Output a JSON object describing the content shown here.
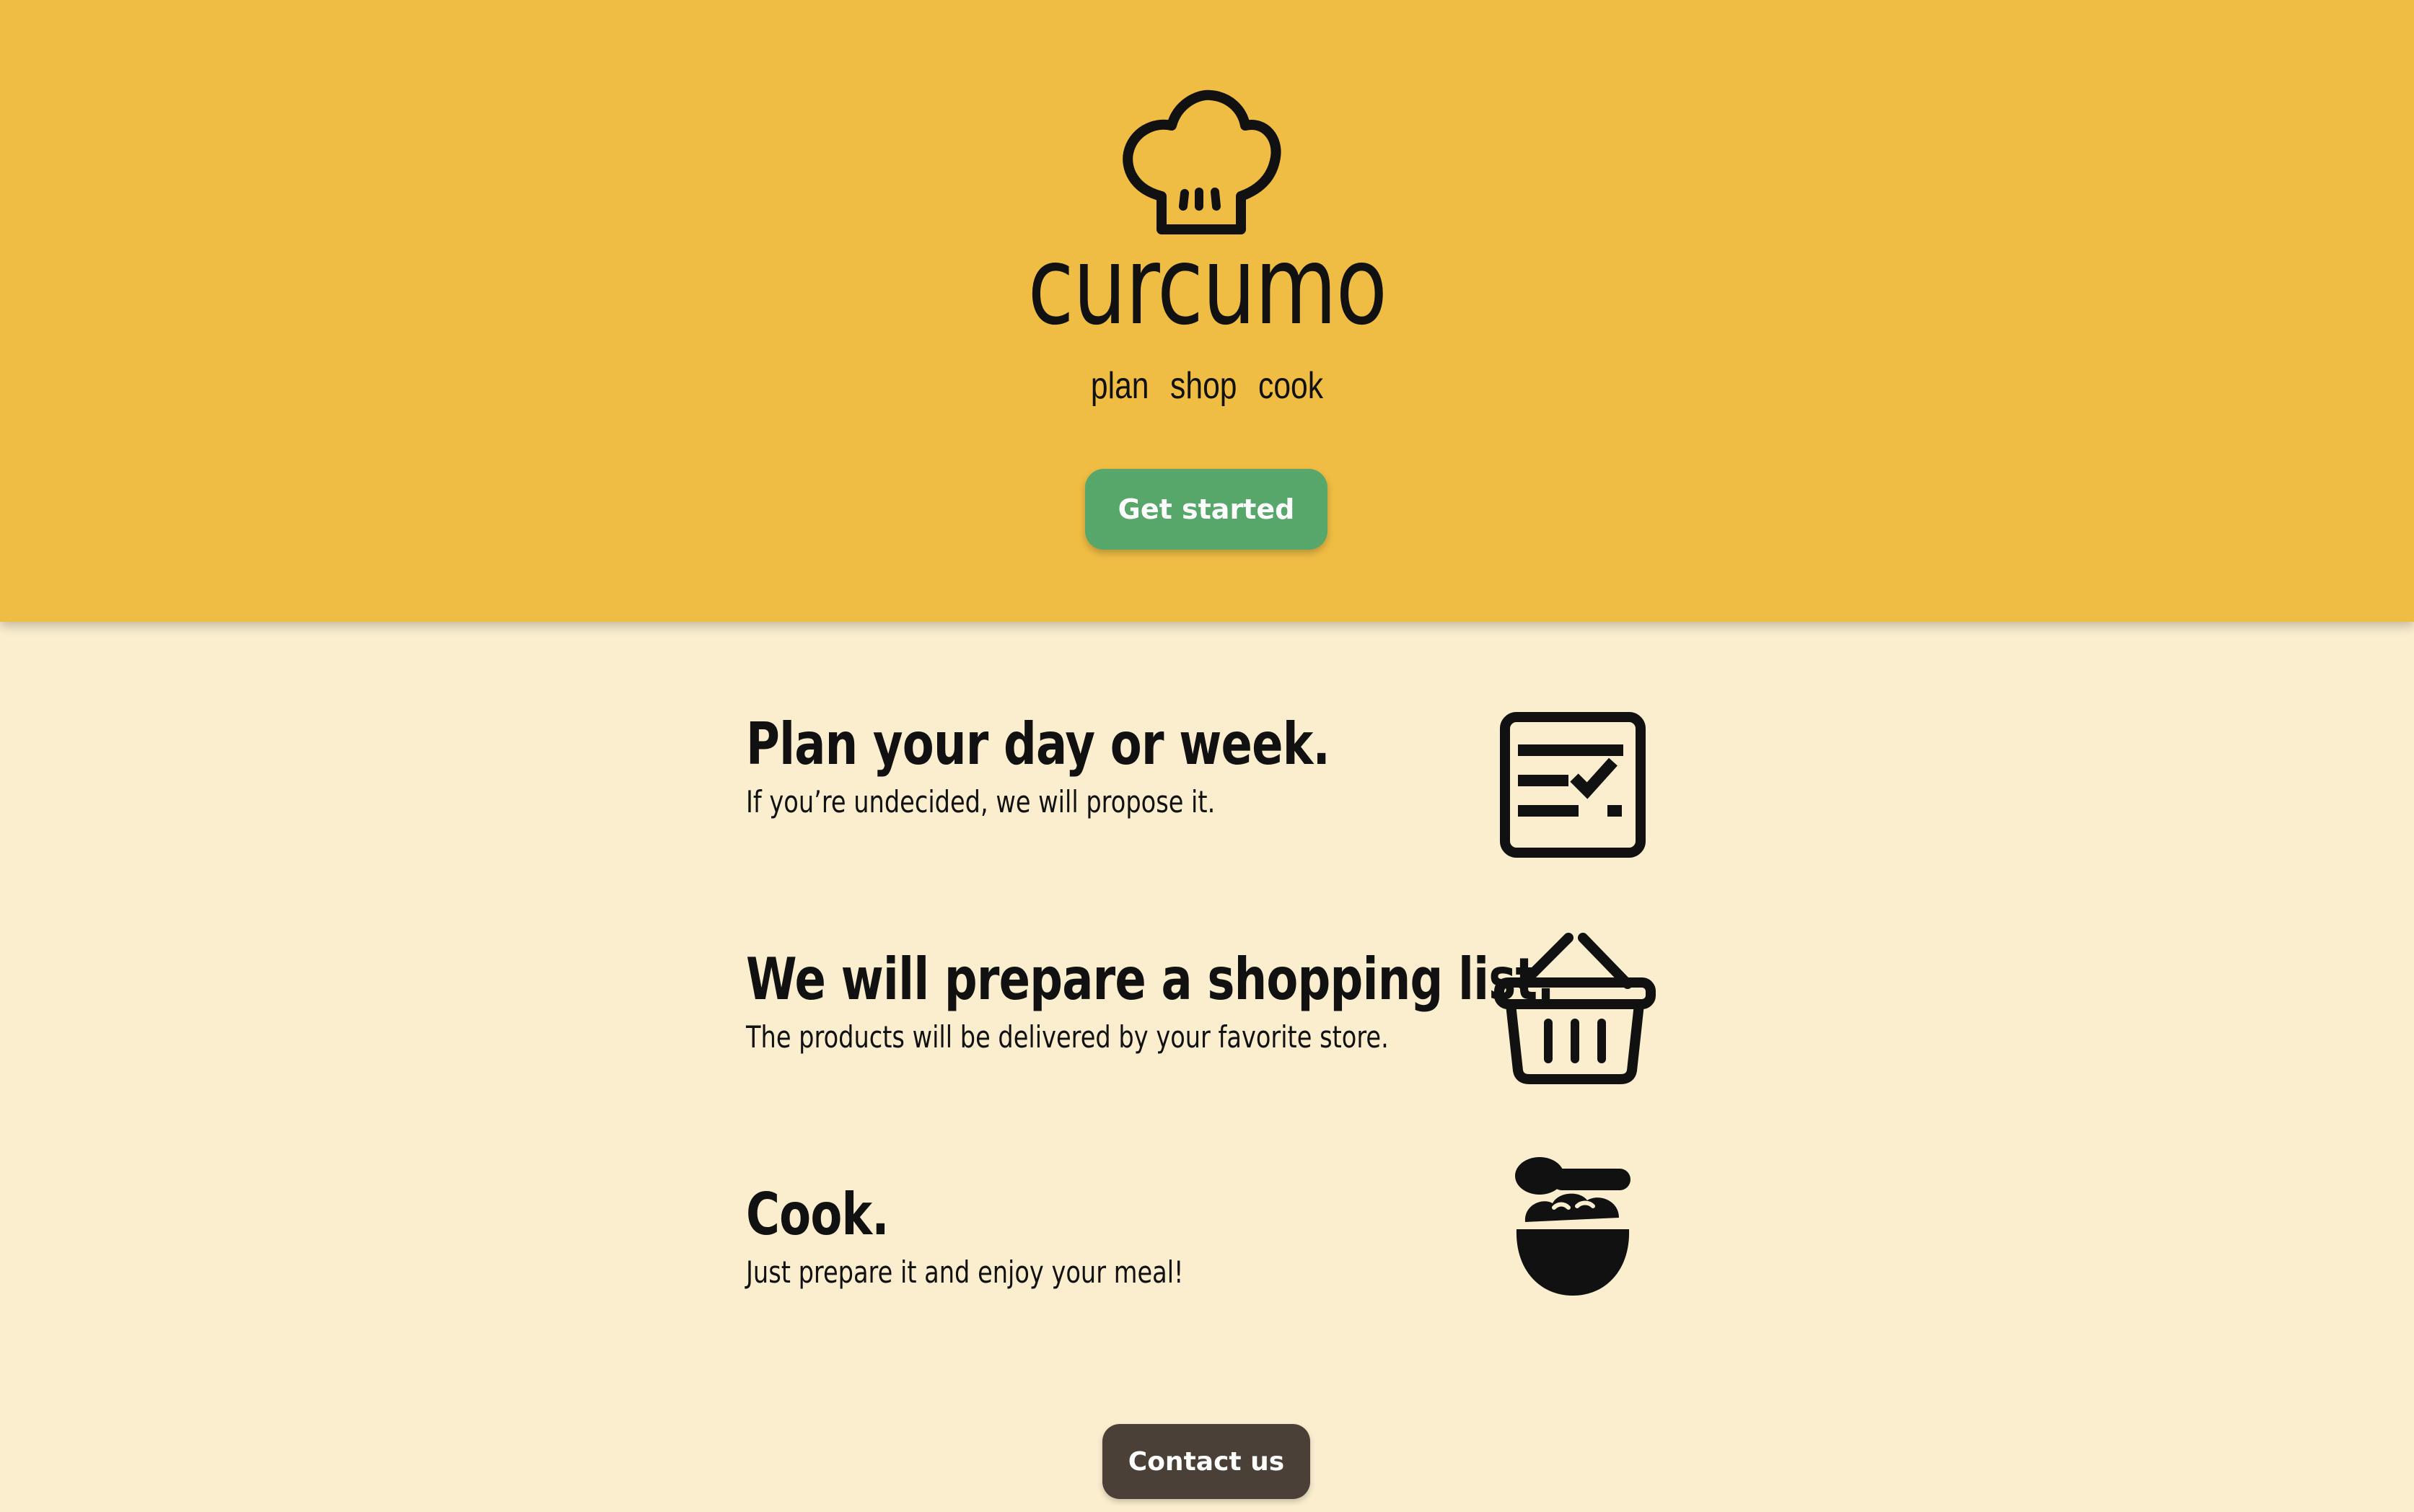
{
  "hero": {
    "brand": "curcumo",
    "tagline": [
      "plan",
      "shop",
      "cook"
    ],
    "cta_label": "Get started",
    "logo_icon": "chef-hat-icon",
    "background": "#f0bd44",
    "cta_color": "#57a76a"
  },
  "features": [
    {
      "title": "Plan your day or week.",
      "subtitle": "If you’re undecided, we will propose it.",
      "icon": "checklist-icon"
    },
    {
      "title": "We will prepare a shopping list.",
      "subtitle": "The products will be delivered by your favorite store.",
      "icon": "shopping-basket-icon"
    },
    {
      "title": "Cook.",
      "subtitle": "Just prepare it and enjoy your meal!",
      "icon": "bowl-spoon-icon"
    }
  ],
  "footer": {
    "contact_label": "Contact us",
    "contact_color": "#4a4038"
  },
  "page_background": "#fbeecf"
}
